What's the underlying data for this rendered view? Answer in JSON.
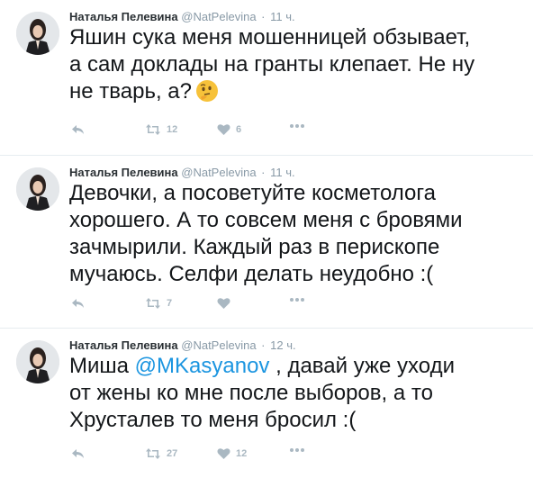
{
  "tweets": [
    {
      "author_name": "Наталья Пелевина",
      "username": "@NatPelevina",
      "separator": "·",
      "time": "11 ч.",
      "text": "Яшин сука меня мошенницей обзывает,\nа сам доклады на гранты клепает. Не ну\nне тварь, а?",
      "emoji": "thinking-face",
      "retweets": "12",
      "likes": "6"
    },
    {
      "author_name": "Наталья Пелевина",
      "username": "@NatPelevina",
      "separator": "·",
      "time": "11 ч.",
      "text": "Девочки, а посоветуйте косметолога\nхорошего. А то совсем меня с бровями\nзачмырили. Каждый раз в перископе\nмучаюсь. Селфи делать неудобно :(",
      "retweets": "7",
      "likes": ""
    },
    {
      "author_name": "Наталья Пелевина",
      "username": "@NatPelevina",
      "separator": "·",
      "time": "12 ч.",
      "text_before": "Миша ",
      "mention": "@MKasyanov",
      "text_after": " , давай уже уходи\nот жены ко мне после выборов, а то\nХрусталев то меня бросил :(",
      "retweets": "27",
      "likes": "12"
    }
  ],
  "icons": {
    "reply": "reply-icon",
    "retweet": "retweet-icon",
    "like": "heart-icon",
    "more": "more-icon"
  },
  "colors": {
    "meta_gray": "#8899a6",
    "action_gray": "#aab8c2",
    "mention_blue": "#1b95e0",
    "divider": "#e6ecf0"
  }
}
